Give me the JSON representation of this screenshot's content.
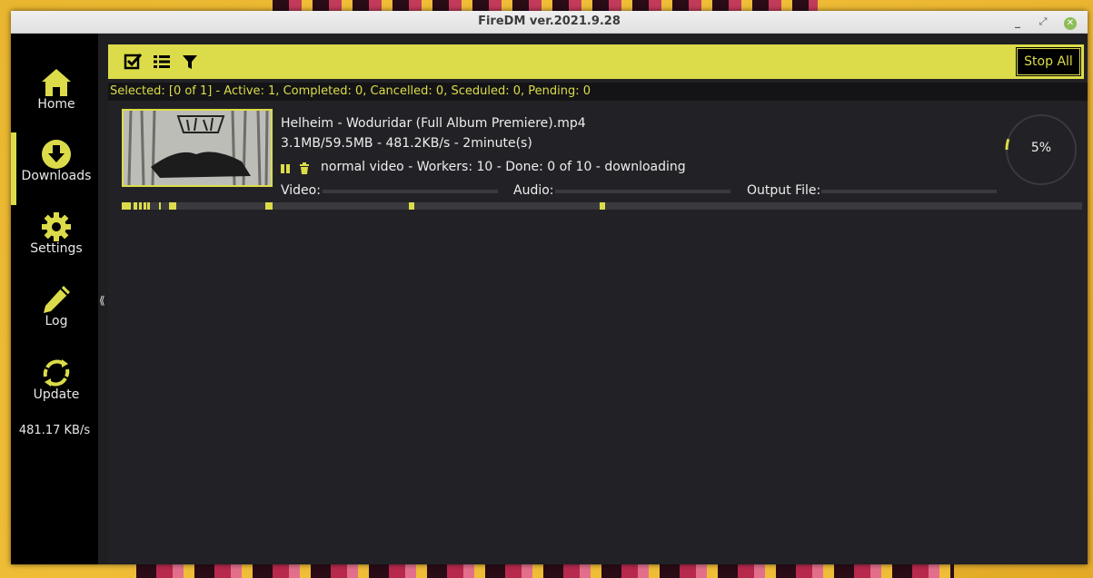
{
  "window": {
    "title": "FireDM ver.2021.9.28"
  },
  "colors": {
    "accent": "#dcdc4a",
    "sidebar_bg": "#000000",
    "main_bg": "#222226"
  },
  "sidebar": {
    "items": [
      {
        "label": "Home",
        "icon": "home-icon"
      },
      {
        "label": "Downloads",
        "icon": "download-icon",
        "active": true
      },
      {
        "label": "Settings",
        "icon": "gear-icon"
      },
      {
        "label": "Log",
        "icon": "pencil-icon"
      },
      {
        "label": "Update",
        "icon": "refresh-icon"
      }
    ],
    "speed": "481.17 KB/s"
  },
  "toolbar": {
    "icons": [
      "select-all-icon",
      "list-icon",
      "filter-icon"
    ],
    "stop_all_label": "Stop All"
  },
  "status": {
    "text": "Selected: [0 of 1] - Active: 1, Completed: 0,  Cancelled: 0,  Sceduled: 0, Pending: 0"
  },
  "download": {
    "name": "Helheim - Woduridar (Full Album Premiere).mp4",
    "size_line": "3.1MB/59.5MB - 481.2KB/s - 2minute(s)",
    "info_line": "normal video - Workers: 10  - Done: 0 of 10 - downloading",
    "video_label": "Video:",
    "audio_label": "Audio:",
    "output_label": "Output File:",
    "progress_text": "5%",
    "progress": 5
  }
}
